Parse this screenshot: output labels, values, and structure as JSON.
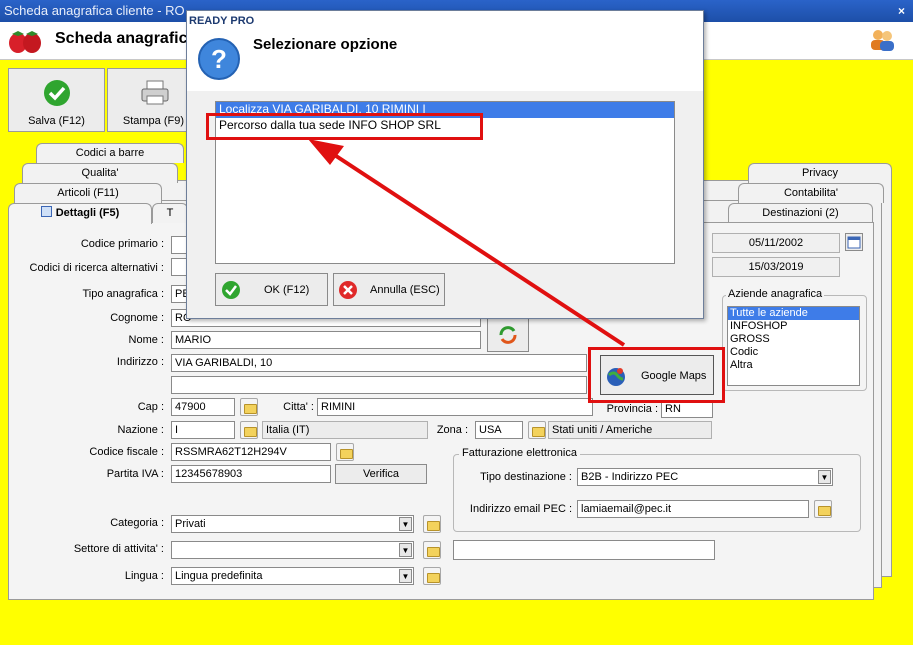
{
  "window": {
    "title": "Scheda anagrafica cliente - RO",
    "close": "×"
  },
  "header": {
    "title": "Scheda anagrafic"
  },
  "toolbar": {
    "save_label": "Salva (F12)",
    "print_label": "Stampa (F9)"
  },
  "tabs": {
    "row1": [
      "Codici a barre",
      "Privacy"
    ],
    "row2": [
      "Qualita'",
      "Contabilita'"
    ],
    "row3": [
      "Articoli (F11)",
      "Destinazioni (2)"
    ],
    "active": "Dettagli (F5)",
    "partial": "T"
  },
  "form": {
    "codice_primario": {
      "label": "Codice primario :",
      "value": ""
    },
    "codici_ricerca": {
      "label": "Codici di ricerca alternativi :",
      "value": ""
    },
    "tipo_anagrafica": {
      "label": "Tipo anagrafica :",
      "value": "PE"
    },
    "cognome": {
      "label": "Cognome :",
      "value": "RO"
    },
    "nome": {
      "label": "Nome :",
      "value": "MARIO"
    },
    "indirizzo": {
      "label": "Indirizzo :",
      "value": "VIA GARIBALDI, 10",
      "value2": ""
    },
    "cap": {
      "label": "Cap :",
      "value": "47900"
    },
    "citta": {
      "label": "Citta' :",
      "value": "RIMINI"
    },
    "provincia": {
      "label": "Provincia :",
      "value": "RN"
    },
    "nazione": {
      "label": "Nazione :",
      "code": "I",
      "name": "Italia (IT)"
    },
    "zona": {
      "label": "Zona :",
      "code": "USA",
      "name": "Stati uniti / Americhe"
    },
    "codice_fiscale": {
      "label": "Codice fiscale :",
      "value": "RSSMRA62T12H294V"
    },
    "partita_iva": {
      "label": "Partita IVA :",
      "value": "12345678903"
    },
    "verifica_label": "Verifica",
    "categoria": {
      "label": "Categoria :",
      "value": "Privati"
    },
    "settore": {
      "label": "Settore di attivita' :",
      "value": "",
      "extra": ""
    },
    "lingua": {
      "label": "Lingua :",
      "value": "Lingua predefinita"
    },
    "date1": "05/11/2002",
    "date2": "15/03/2019"
  },
  "fatturazione": {
    "title": "Fatturazione elettronica",
    "tipo_label": "Tipo destinazione :",
    "tipo_value": "B2B - Indirizzo PEC",
    "pec_label": "Indirizzo email PEC :",
    "pec_value": "lamiaemail@pec.it"
  },
  "aziende": {
    "title": "Aziende anagrafica",
    "items": [
      "Tutte le aziende",
      "INFOSHOP",
      "GROSS",
      "Codic",
      "Altra"
    ],
    "selected_index": 0
  },
  "google_maps_label": "Google Maps",
  "dialog": {
    "title": "READY PRO",
    "heading": "Selezionare opzione",
    "options": [
      "Localizza VIA GARIBALDI, 10 RIMINI I",
      "Percorso dalla tua sede INFO SHOP SRL"
    ],
    "selected_index": 0,
    "ok_label": "OK (F12)",
    "cancel_label": "Annulla (ESC)"
  },
  "colors": {
    "background": "#ffff00",
    "highlight": "#e01010",
    "selection": "#3e7ce8",
    "titlebar": "#2a63c9"
  }
}
